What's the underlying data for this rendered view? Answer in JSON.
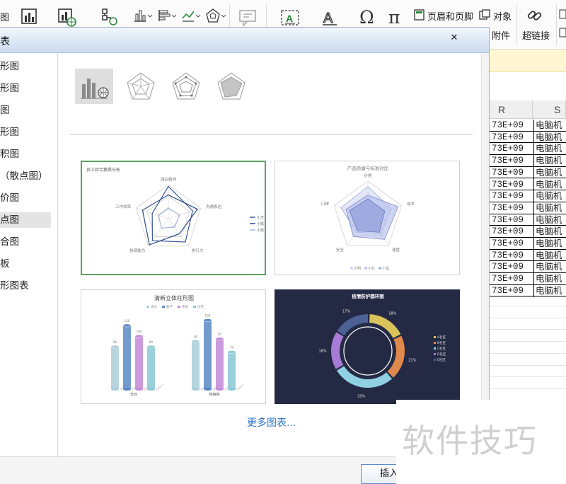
{
  "ribbon": {
    "chart_group_label": "图",
    "header_footer_label": "页眉和页脚",
    "object_label": "对象",
    "attachment_label": "附件",
    "hyperlink_label": "超链接"
  },
  "sheet": {
    "col_r": "R",
    "col_s": "S",
    "rows": [
      {
        "num": "73E+09",
        "text": "电脑机"
      },
      {
        "num": "73E+09",
        "text": "电脑机"
      },
      {
        "num": "73E+09",
        "text": "电脑机"
      },
      {
        "num": "73E+09",
        "text": "电脑机"
      },
      {
        "num": "73E+09",
        "text": "电脑机"
      },
      {
        "num": "73E+09",
        "text": "电脑机"
      },
      {
        "num": "73E+09",
        "text": "电脑机"
      },
      {
        "num": "73E+09",
        "text": "电脑机"
      },
      {
        "num": "73E+09",
        "text": "电脑机"
      },
      {
        "num": "73E+09",
        "text": "电脑机"
      },
      {
        "num": "73E+09",
        "text": "电脑机"
      },
      {
        "num": "73E+09",
        "text": "电脑机"
      },
      {
        "num": "73E+09",
        "text": "电脑机"
      },
      {
        "num": "73E+09",
        "text": "电脑机"
      },
      {
        "num": "73E+09",
        "text": "电脑机"
      }
    ]
  },
  "dialog": {
    "title": "表",
    "close": "✕",
    "nav": [
      {
        "label": "形图"
      },
      {
        "label": "形图"
      },
      {
        "label": "图"
      },
      {
        "label": "形图"
      },
      {
        "label": "积图"
      },
      {
        "label": "（散点图）"
      },
      {
        "label": "价图"
      },
      {
        "label": "点图"
      },
      {
        "label": "合图"
      },
      {
        "label": "板"
      },
      {
        "label": "形图表"
      }
    ],
    "selected_nav_index": 7,
    "more_link": "更多图表...",
    "insert_button": "插入"
  },
  "templates": [
    {
      "title": "员工综合素质分析",
      "axes": [
        "团队精神",
        "沟通表达",
        "执行力",
        "协调能力",
        "工作效率"
      ],
      "legend": [
        "小王",
        "小陈",
        "小张"
      ],
      "series_colors": [
        "#3a5a98",
        "#2d4a86",
        "#a8b8d8"
      ]
    },
    {
      "title": "产品质量与标准对比",
      "axes": [
        "价格",
        "成本",
        "速度",
        "安全",
        "口碑"
      ],
      "legend": [
        "小明",
        "小红",
        "小黑"
      ]
    },
    {
      "title": "清新立体柱形图",
      "legend": [
        "语文",
        "数学",
        "英语",
        "历史"
      ],
      "categories": [
        "李四",
        "韩梅梅"
      ],
      "value_labels": [
        "80",
        "120",
        "100",
        "80",
        "90",
        "130",
        "95",
        "70"
      ]
    },
    {
      "title": "疫情防护圆环图",
      "legend": [
        "A社区",
        "B社区",
        "C社区",
        "D社区",
        "E社区"
      ],
      "segment_labels": [
        "18%",
        "21%",
        "29%",
        "18%",
        "17%"
      ]
    }
  ],
  "chart_data": [
    {
      "type": "radar",
      "title": "员工综合素质分析",
      "categories": [
        "团队精神",
        "沟通表达",
        "执行力",
        "协调能力",
        "工作效率"
      ],
      "series": [
        {
          "name": "小王",
          "values": [
            0.95,
            0.75,
            0.85,
            0.8,
            0.5
          ]
        },
        {
          "name": "小陈",
          "values": [
            0.7,
            0.9,
            0.55,
            0.95,
            0.8
          ]
        },
        {
          "name": "小张",
          "values": [
            0.3,
            0.35,
            0.3,
            0.35,
            0.3
          ]
        }
      ]
    },
    {
      "type": "radar",
      "title": "产品质量与标准对比",
      "categories": [
        "价格",
        "成本",
        "速度",
        "安全",
        "口碑"
      ],
      "series": [
        {
          "name": "小明",
          "values": [
            0.85,
            0.7,
            0.6,
            0.55,
            0.8
          ]
        },
        {
          "name": "小红",
          "values": [
            0.6,
            0.9,
            0.8,
            0.7,
            0.65
          ]
        },
        {
          "name": "小黑",
          "values": [
            0.5,
            0.5,
            0.55,
            0.5,
            0.55
          ]
        }
      ]
    },
    {
      "type": "bar",
      "title": "清新立体柱形图",
      "categories": [
        "李四",
        "韩梅梅"
      ],
      "series": [
        {
          "name": "语文",
          "values": [
            80,
            90
          ]
        },
        {
          "name": "数学",
          "values": [
            120,
            130
          ]
        },
        {
          "name": "英语",
          "values": [
            100,
            95
          ]
        },
        {
          "name": "历史",
          "values": [
            80,
            70
          ]
        }
      ],
      "colors": [
        "#a9cdd8",
        "#5b88c4",
        "#c48ad6",
        "#8ac8d3"
      ]
    },
    {
      "type": "pie",
      "title": "疫情防护圆环图",
      "categories": [
        "A社区",
        "B社区",
        "C社区",
        "D社区",
        "E社区"
      ],
      "values": [
        18,
        21,
        29,
        18,
        17
      ],
      "labels": [
        "18%",
        "21%",
        "29%",
        "18%",
        "17%"
      ],
      "colors": [
        "#d9c35b",
        "#e0894e",
        "#8fd0e3",
        "#a77bd6",
        "#4c6296"
      ]
    }
  ],
  "watermark": "软件技巧"
}
